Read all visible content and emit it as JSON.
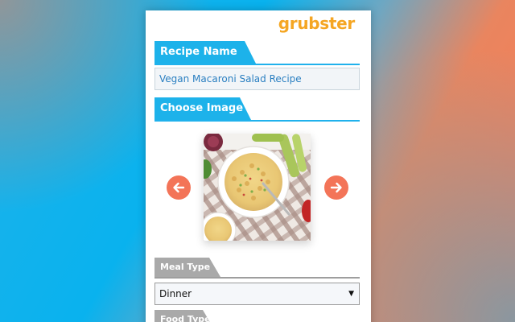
{
  "brand": {
    "logo_text": "grubster",
    "logo_color": "#f5a623"
  },
  "colors": {
    "accent_blue": "#1db2ea",
    "accent_orange": "#f37458",
    "section_gray": "#a9a9a9"
  },
  "recipe_name": {
    "header": "Recipe Name",
    "value": "Vegan Macaroni Salad Recipe"
  },
  "choose_image": {
    "header": "Choose Image",
    "prev_icon": "arrow-left-icon",
    "next_icon": "arrow-right-icon"
  },
  "meal_type": {
    "header": "Meal Type",
    "selected": "Dinner"
  },
  "food_type": {
    "header": "Food Type"
  }
}
